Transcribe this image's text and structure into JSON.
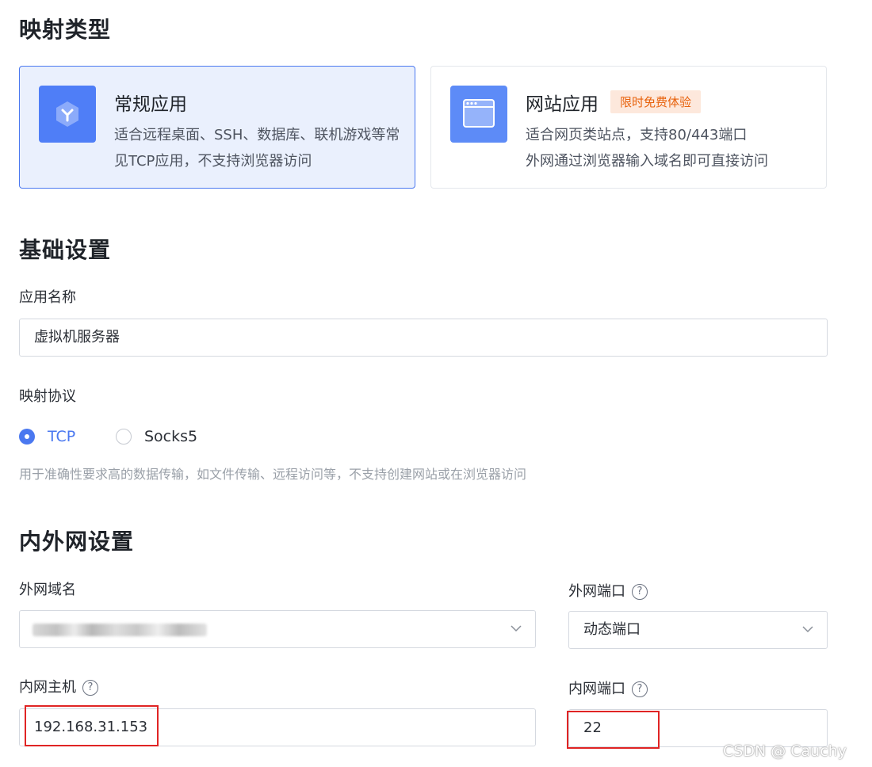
{
  "sections": {
    "mapping_type": "映射类型",
    "basic": "基础设置",
    "network": "内外网设置"
  },
  "cards": {
    "regular": {
      "title": "常规应用",
      "desc": "适合远程桌面、SSH、数据库、联机游戏等常见TCP应用，不支持浏览器访问",
      "icon": "app-y-icon",
      "selected": true
    },
    "website": {
      "title": "网站应用",
      "badge": "限时免费体验",
      "desc_line1": "适合网页类站点，支持80/443端口",
      "desc_line2": "外网通过浏览器输入域名即可直接访问",
      "icon": "browser-window-icon",
      "selected": false
    }
  },
  "app_name": {
    "label": "应用名称",
    "value": "虚拟机服务器"
  },
  "protocol": {
    "label": "映射协议",
    "options": [
      {
        "label": "TCP",
        "selected": true
      },
      {
        "label": "Socks5",
        "selected": false
      }
    ],
    "hint": "用于准确性要求高的数据传输，如文件传输、远程访问等，不支持创建网站或在浏览器访问"
  },
  "external_domain": {
    "label": "外网域名",
    "value": ""
  },
  "external_port": {
    "label": "外网端口",
    "value": "动态端口"
  },
  "internal_host": {
    "label": "内网主机",
    "value": "192.168.31.153"
  },
  "internal_port": {
    "label": "内网端口",
    "value": "22"
  },
  "watermark": "CSDN @ Cauchy",
  "colors": {
    "accent": "#4a78f0",
    "badge_text": "#e8620c",
    "badge_bg": "#fde8dc",
    "highlight": "#e02424"
  }
}
